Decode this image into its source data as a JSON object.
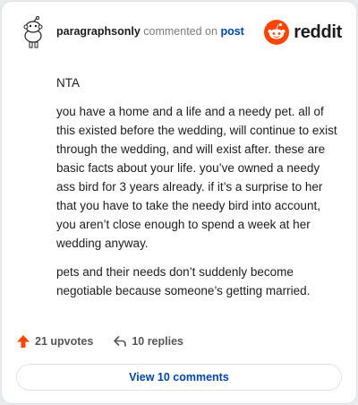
{
  "header": {
    "username": "paragraphsonly",
    "action": "commented on",
    "target": "post",
    "brand": "reddit"
  },
  "comment": {
    "paragraphs": [
      "NTA",
      "you have a home and a life and a needy pet. all of this existed before the wedding, will continue to exist through the wedding, and will exist after. these are basic facts about your life. you’ve owned a needy ass bird for 3 years already. if it’s a surprise to her that you have to take the needy bird into account, you aren’t close enough to spend a week at her wedding anyway.",
      "pets and their needs don’t suddenly become negotiable because someone’s getting married."
    ]
  },
  "footer": {
    "upvotes": "21 upvotes",
    "replies": "10 replies",
    "view_comments": "View 10 comments"
  },
  "colors": {
    "brand_orange": "#ff4500",
    "link_blue": "#0045ac"
  }
}
